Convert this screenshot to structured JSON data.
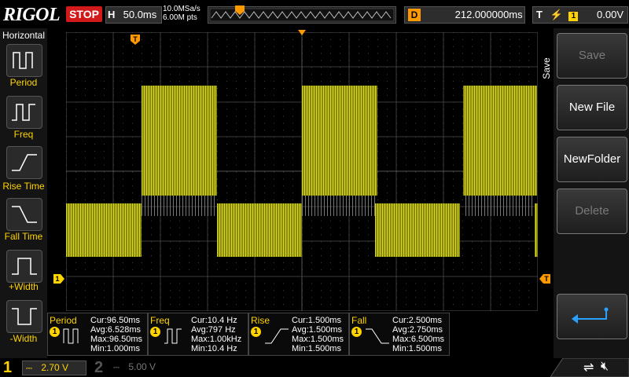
{
  "top": {
    "brand": "RIGOL",
    "run_state": "STOP",
    "horizontal_key": "H",
    "timebase": "50.0ms",
    "sample_rate": "10.0MSa/s",
    "memory_depth": "6.00M pts",
    "delay_key": "D",
    "delay": "212.000000ms",
    "trigger_key": "T",
    "trigger_source": "1",
    "trigger_level": "0.00V"
  },
  "left_menu": {
    "title": "Horizontal",
    "items": [
      {
        "label": "Period"
      },
      {
        "label": "Freq"
      },
      {
        "label": "Rise Time"
      },
      {
        "label": "Fall Time"
      },
      {
        "label": "+Width"
      },
      {
        "label": "-Width"
      }
    ]
  },
  "right_menu": {
    "title": "Save",
    "buttons": [
      {
        "label": "Save",
        "enabled": false
      },
      {
        "label": "New File",
        "enabled": true
      },
      {
        "label": "NewFolder",
        "enabled": true
      },
      {
        "label": "Delete",
        "enabled": false
      }
    ]
  },
  "markers": {
    "trigger_pos": "T",
    "ch1_ground": "1"
  },
  "measurements": [
    {
      "name": "Period",
      "channel": "1",
      "cur": "Cur:96.50ms",
      "avg": "Avg:6.528ms",
      "max": "Max:96.50ms",
      "min": "Min:1.000ms"
    },
    {
      "name": "Freq",
      "channel": "1",
      "cur": "Cur:10.4 Hz",
      "avg": "Avg:797 Hz",
      "max": "Max:1.00kHz",
      "min": "Min:10.4 Hz"
    },
    {
      "name": "Rise",
      "channel": "1",
      "cur": "Cur:1.500ms",
      "avg": "Avg:1.500ms",
      "max": "Max:1.500ms",
      "min": "Min:1.500ms"
    },
    {
      "name": "Fall",
      "channel": "1",
      "cur": "Cur:2.500ms",
      "avg": "Avg:2.750ms",
      "max": "Max:6.500ms",
      "min": "Min:1.500ms"
    }
  ],
  "channels": [
    {
      "number": "1",
      "scale": "2.70 V",
      "color": "#ffd400"
    },
    {
      "number": "2",
      "scale": "5.00 V",
      "color": "#555555"
    }
  ],
  "colors": {
    "ch1": "#d6d60a",
    "stop": "#d31a1a",
    "accent": "#ff9900",
    "grid": "#3a3a3a"
  }
}
